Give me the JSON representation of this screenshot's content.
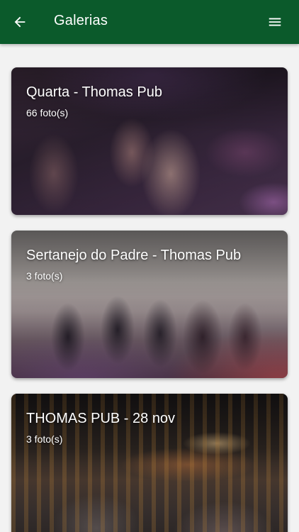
{
  "appbar": {
    "title": "Galerias",
    "color": "#0b5a2b",
    "back_icon": "arrow-left-icon",
    "menu_icon": "hamburger-menu-icon"
  },
  "galleries": [
    {
      "title": "Quarta - Thomas Pub",
      "count": "66 foto(s)"
    },
    {
      "title": "Sertanejo do Padre - Thomas Pub",
      "count": "3 foto(s)"
    },
    {
      "title": "THOMAS PUB - 28 nov",
      "count": "3 foto(s)"
    }
  ]
}
